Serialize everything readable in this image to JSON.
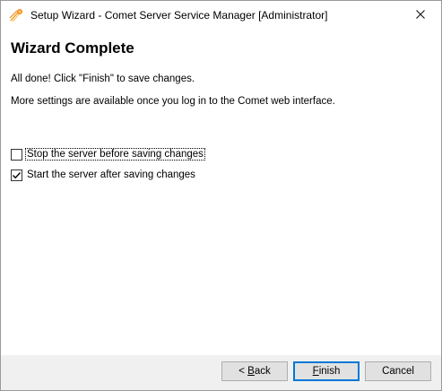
{
  "window": {
    "title": "Setup Wizard - Comet Server Service Manager [Administrator]",
    "app_icon": "comet-icon",
    "close_icon": "close-icon"
  },
  "main": {
    "heading": "Wizard Complete",
    "message": "All done! Click \"Finish\" to save changes.",
    "info": "More settings are available once you log in to the Comet web interface."
  },
  "options": [
    {
      "label": "Stop the server before saving changes",
      "checked": false
    },
    {
      "label": "Start the server after saving changes",
      "checked": true
    }
  ],
  "buttons": {
    "back": {
      "prefix": "< ",
      "mnemonic": "B",
      "rest": "ack"
    },
    "finish": {
      "prefix": "",
      "mnemonic": "F",
      "rest": "inish"
    },
    "cancel": {
      "label": "Cancel"
    }
  },
  "colors": {
    "accent": "#0078d7",
    "footer_bg": "#f0f0f0",
    "button_bg": "#e1e1e1"
  }
}
